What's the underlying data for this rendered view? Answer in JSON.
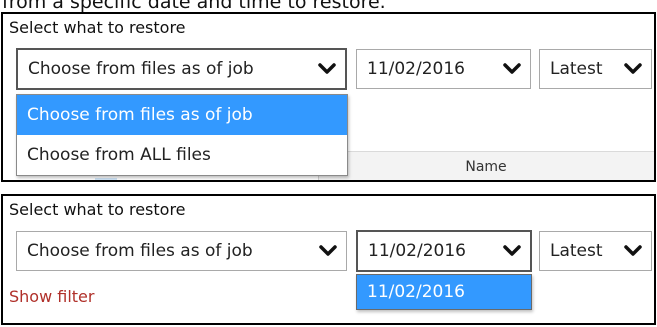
{
  "caption": "from a specific date and time to restore.",
  "panel1": {
    "title": "Select what to restore",
    "source_select": "Choose from files as of job",
    "date_select": "11/02/2016",
    "version_select": "Latest",
    "menu_options": [
      "Choose from files as of job",
      "Choose from ALL files"
    ],
    "column_name": "Name"
  },
  "panel2": {
    "title": "Select what to restore",
    "source_select": "Choose from files as of job",
    "date_select": "11/02/2016",
    "version_select": "Latest",
    "date_menu_options": [
      "11/02/2016"
    ],
    "show_filter": "Show filter"
  },
  "colors": {
    "selection": "#3399ff",
    "filter_link": "#b0302a",
    "panel_border": "#000000"
  },
  "icons": {
    "dropdown_arrow": "chevron-down-icon"
  }
}
